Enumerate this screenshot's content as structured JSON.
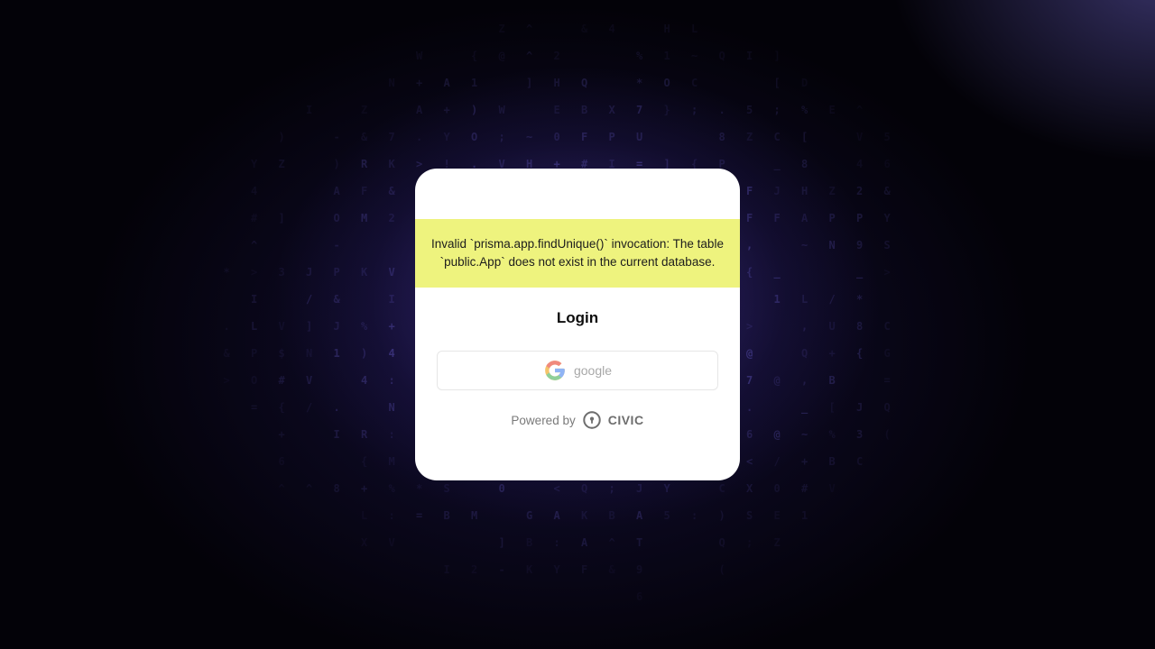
{
  "error": {
    "message": "Invalid `prisma.app.findUnique()` invocation: The table `public.App` does not exist in the current database."
  },
  "login": {
    "title": "Login",
    "google_label": "google",
    "google_icon": "google-icon"
  },
  "footer": {
    "powered_by": "Powered by",
    "brand": "CIVIC",
    "brand_icon": "civic-icon"
  },
  "colors": {
    "error_banner": "#eef37e",
    "card": "#ffffff",
    "background_glow": "#5a46be"
  }
}
